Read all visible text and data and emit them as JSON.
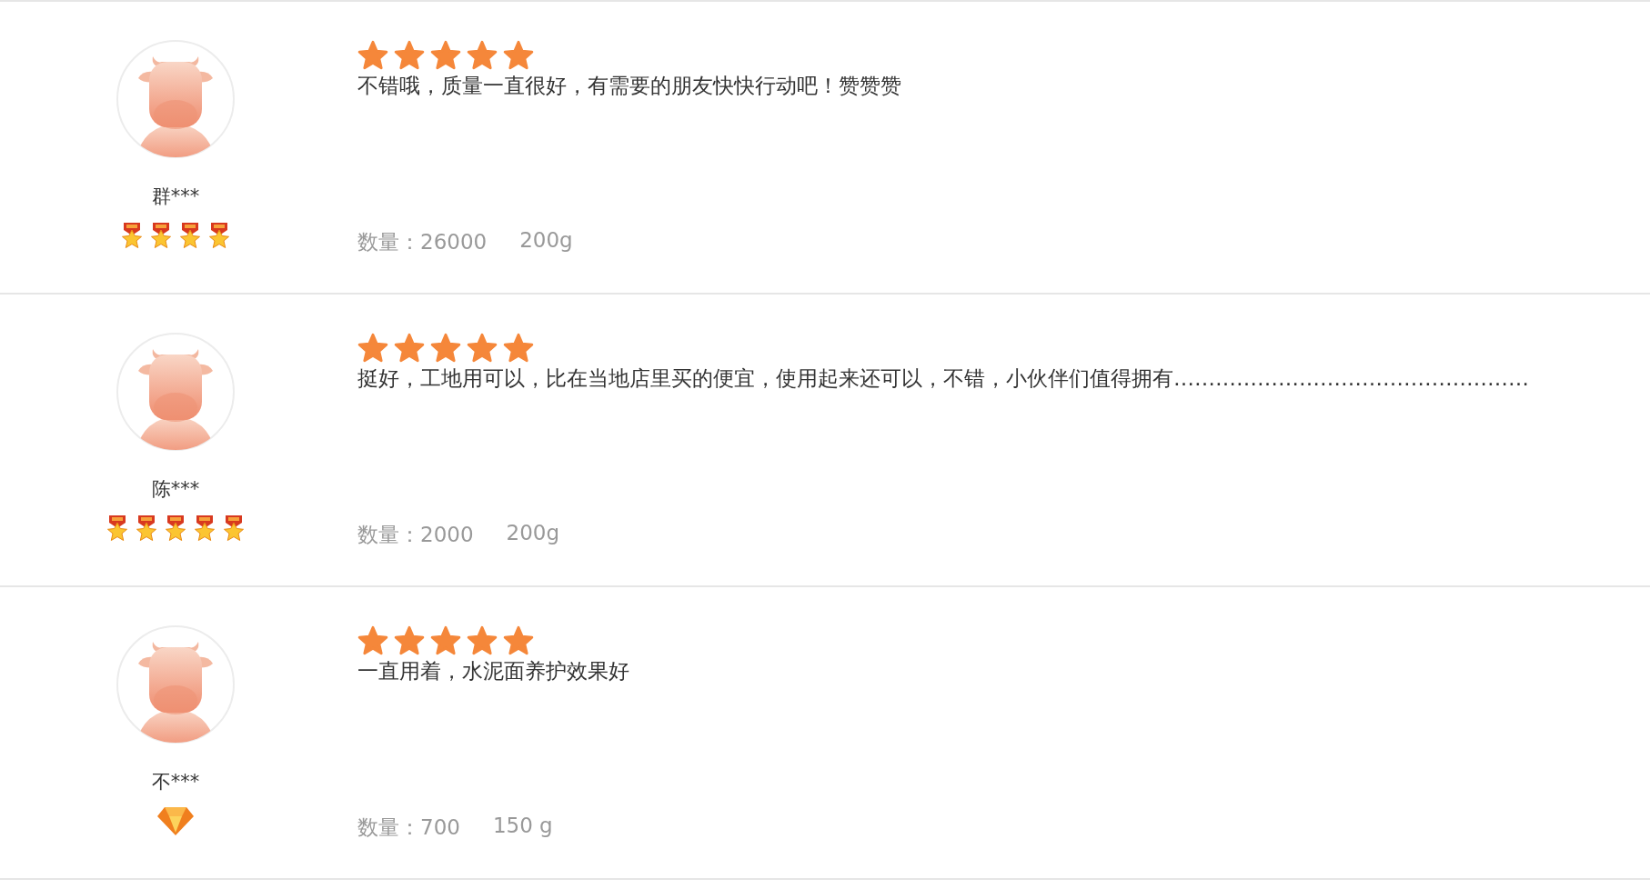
{
  "reviews": [
    {
      "user": "群***",
      "badges": [
        {
          "kind": "medal"
        },
        {
          "kind": "medal"
        },
        {
          "kind": "medal"
        },
        {
          "kind": "medal"
        }
      ],
      "stars": 5,
      "comment": "不错哦，质量一直很好，有需要的朋友快快行动吧！赞赞赞",
      "quantity": "数量：26000",
      "spec": "200g"
    },
    {
      "user": "陈***",
      "badges": [
        {
          "kind": "medal"
        },
        {
          "kind": "medal"
        },
        {
          "kind": "medal"
        },
        {
          "kind": "medal"
        },
        {
          "kind": "medal"
        }
      ],
      "stars": 5,
      "comment": "挺好，工地用可以，比在当地店里买的便宜，使用起来还可以，不错，小伙伴们值得拥有……………………………………………",
      "quantity": "数量：2000",
      "spec": "200g"
    },
    {
      "user": "不***",
      "badges": [
        {
          "kind": "diamond"
        }
      ],
      "stars": 5,
      "comment": "一直用着，水泥面养护效果好",
      "quantity": "数量：700",
      "spec": "150 g"
    }
  ]
}
